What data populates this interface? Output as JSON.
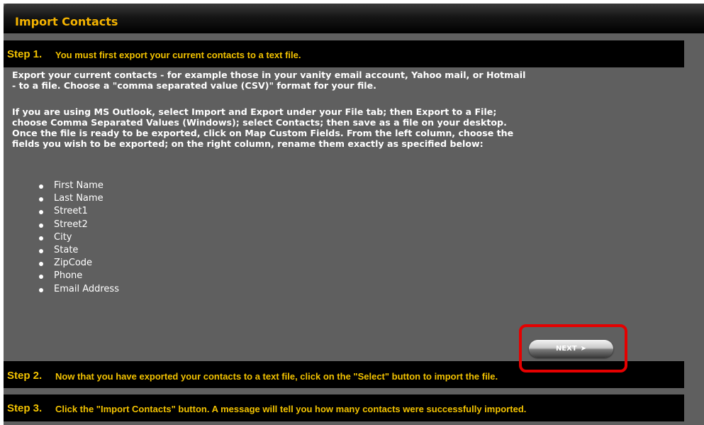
{
  "title": "Import Contacts",
  "steps": [
    {
      "number": "Step 1.",
      "text": "You must first export your current contacts to a text file."
    },
    {
      "number": "Step 2.",
      "text": "Now that you have exported your contacts to a text file, click on the \"Select\" button to import the file."
    },
    {
      "number": "Step 3.",
      "text": "Click the \"Import Contacts\" button. A message will tell you how many contacts were successfully imported."
    }
  ],
  "instructions": {
    "para1": "Export your current contacts - for example those in your vanity email account, Yahoo mail, or Hotmail\n- to a file. Choose a \"comma separated value (CSV)\" format for your file.",
    "para2": "If you are using MS Outlook, select Import and Export under your File tab; then Export to a File;\nchoose Comma Separated Values (Windows); select Contacts; then save as a file on your desktop.\nOnce the file is ready to be exported, click on Map Custom Fields. From the left column, choose the\nfields you wish to be exported; on the right column, rename them exactly as specified below:"
  },
  "fields": [
    "First Name",
    "Last Name",
    "Street1",
    "Street2",
    "City",
    "State",
    "ZipCode",
    "Phone",
    "Email Address"
  ],
  "next_button": {
    "label": "NEXT",
    "arrow": "➤"
  },
  "colors": {
    "panel_background": "#5f5f5f",
    "title_text": "#f4b300",
    "step_text": "#f2c200",
    "step_background": "#000000",
    "highlight": "#e50000"
  }
}
